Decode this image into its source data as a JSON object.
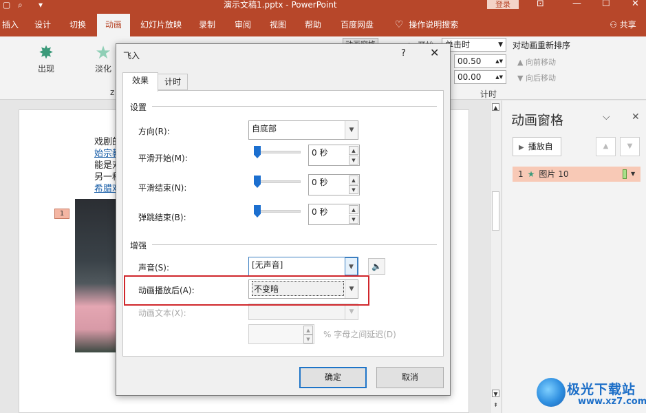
{
  "titlebar": {
    "doc_title": "演示文稿1.pptx  -  PowerPoint",
    "login": "登录"
  },
  "ribbon_tabs": [
    {
      "label": "插入"
    },
    {
      "label": "设计"
    },
    {
      "label": "切换"
    },
    {
      "label": "动画"
    },
    {
      "label": "幻灯片放映"
    },
    {
      "label": "录制"
    },
    {
      "label": "审阅"
    },
    {
      "label": "视图"
    },
    {
      "label": "帮助"
    },
    {
      "label": "百度网盘"
    },
    {
      "label": "操作说明搜索"
    }
  ],
  "share": "共享",
  "ribbon": {
    "effects": [
      {
        "label": "出现"
      },
      {
        "label": "淡化"
      }
    ],
    "start_value": "单击时",
    "start_label": "开始:",
    "duration_value": "00.50",
    "delay_value": "00.00",
    "timing_group_label": "计时",
    "reorder_title": "对动画重新排序",
    "move_earlier": "向前移动",
    "move_later": "向后移动",
    "anim_pane_button": "动画窗格"
  },
  "slide": {
    "text_lines": [
      "戏剧的",
      "始宗教",
      "能是对",
      "另一种",
      "希腊戏"
    ],
    "badge": "1"
  },
  "anim_pane": {
    "title": "动画窗格",
    "play_button": "播放自",
    "item": {
      "index": "1",
      "name": "图片 10"
    }
  },
  "dialog": {
    "title": "飞入",
    "help": "?",
    "tabs": [
      {
        "label": "效果"
      },
      {
        "label": "计时"
      }
    ],
    "settings_section": "设置",
    "direction_label": "方向(R):",
    "direction_value": "自底部",
    "smooth_start_label": "平滑开始(M):",
    "smooth_start_value": "0 秒",
    "smooth_end_label": "平滑结束(N):",
    "smooth_end_value": "0 秒",
    "bounce_end_label": "弹跳结束(B):",
    "bounce_end_value": "0 秒",
    "enhance_section": "增强",
    "sound_label": "声音(S):",
    "sound_value": "[无声音]",
    "after_anim_label": "动画播放后(A):",
    "after_anim_value": "不变暗",
    "anim_text_label": "动画文本(X):",
    "anim_text_value": "",
    "delay_between_label": "% 字母之间延迟(D)",
    "ok": "确定",
    "cancel": "取消"
  },
  "watermark": {
    "cn": "极光下载站",
    "url": "www.xz7.com"
  }
}
